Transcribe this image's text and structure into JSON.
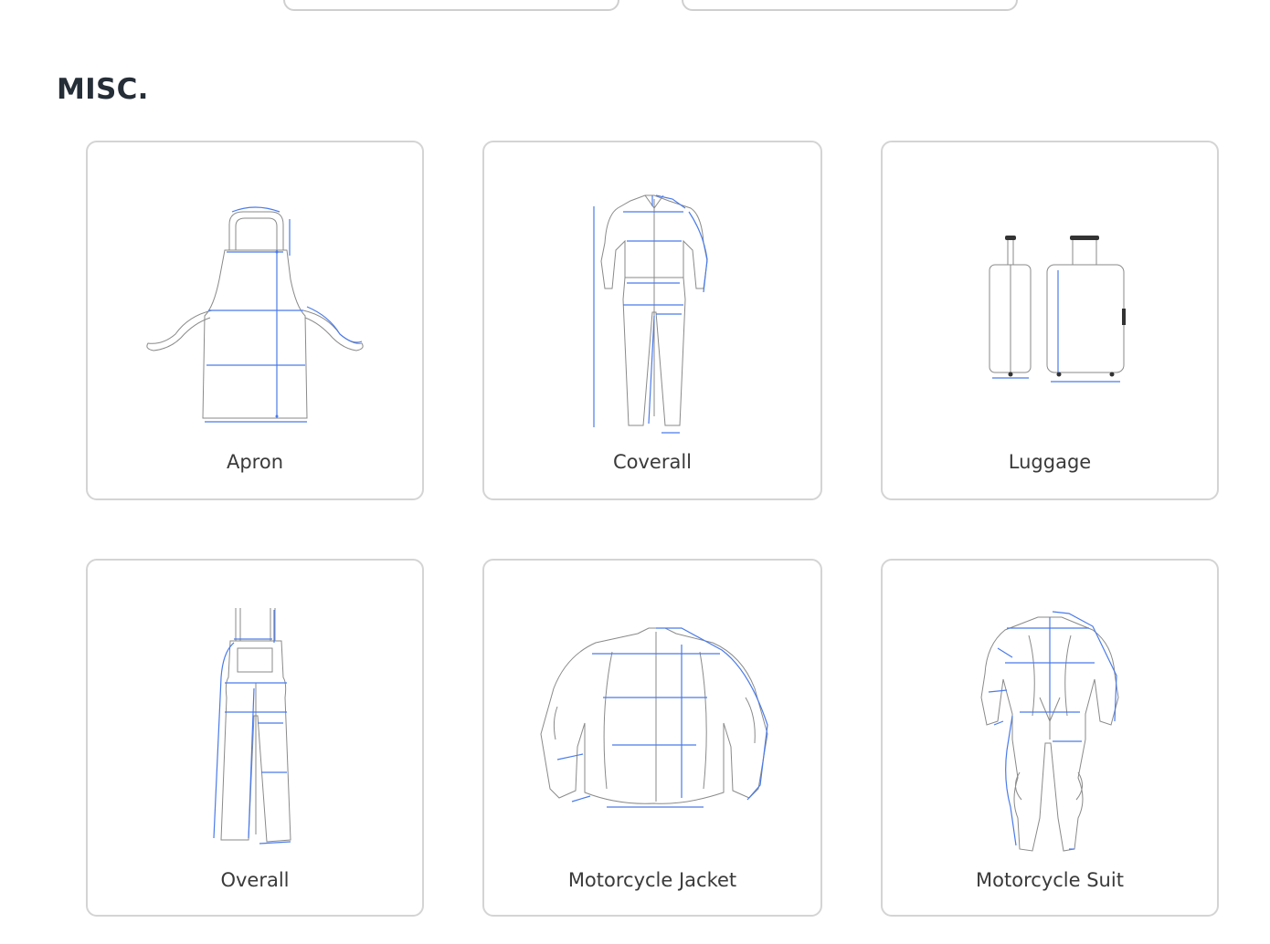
{
  "section": {
    "title": "MISC."
  },
  "items": [
    {
      "label": "Apron",
      "icon": "apron-icon"
    },
    {
      "label": "Coverall",
      "icon": "coverall-icon"
    },
    {
      "label": "Luggage",
      "icon": "luggage-icon"
    },
    {
      "label": "Overall",
      "icon": "overall-icon"
    },
    {
      "label": "Motorcycle Jacket",
      "icon": "motorcycle-jacket-icon"
    },
    {
      "label": "Motorcycle Suit",
      "icon": "motorcycle-suit-icon"
    }
  ],
  "colors": {
    "measure_lines": "#4a7bea",
    "outline": "#8a8a8a",
    "card_border": "#d4d4d4",
    "title": "#252d37"
  }
}
